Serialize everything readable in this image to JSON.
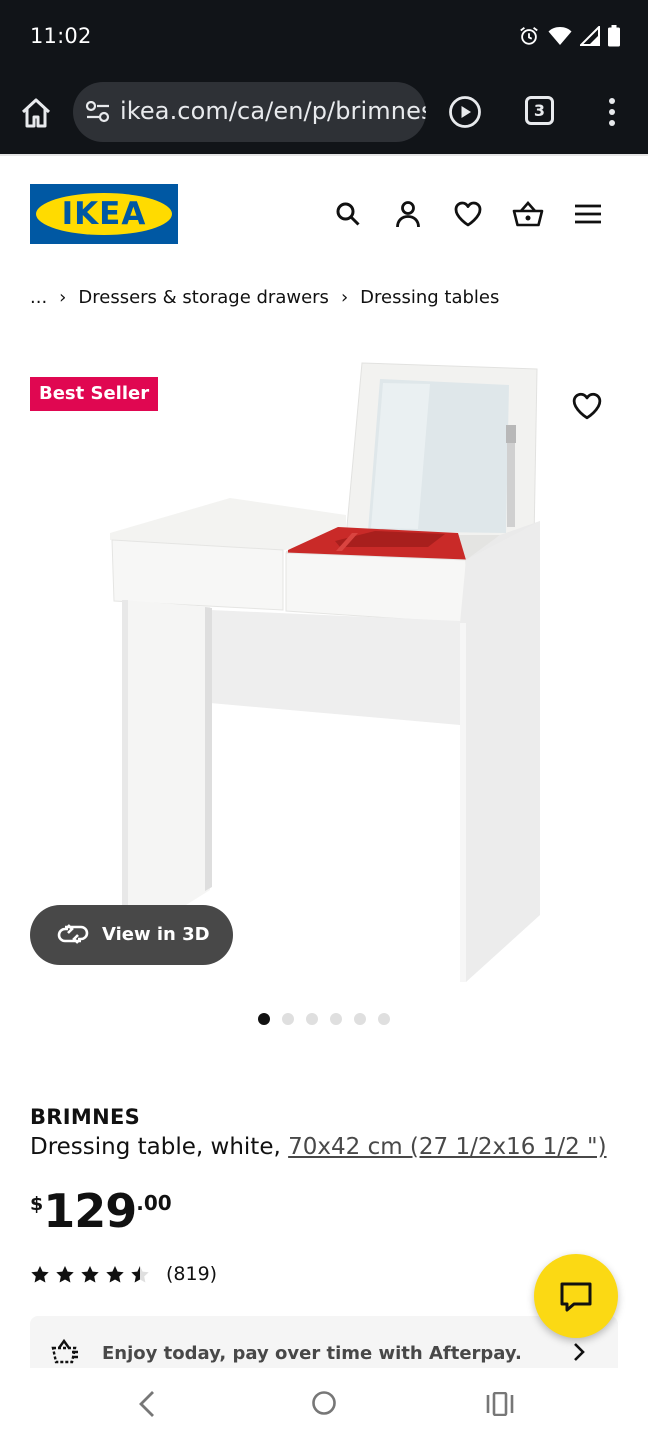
{
  "status_bar": {
    "time": "11:02",
    "icons": [
      "alarm-icon",
      "wifi-icon",
      "signal-icon",
      "battery-icon"
    ]
  },
  "browser": {
    "url": "ikea.com/ca/en/p/brimnes-d",
    "tab_count": "3",
    "icons": [
      "home-icon",
      "tune-icon",
      "play-circle-icon",
      "more-vert-icon"
    ]
  },
  "header": {
    "logo_text": "IKEA",
    "icons": [
      "search-icon",
      "user-icon",
      "heart-icon",
      "basket-icon",
      "menu-icon"
    ],
    "colors": {
      "logo_blue": "#0058a3",
      "logo_yellow": "#ffdb00"
    }
  },
  "breadcrumb": {
    "items": [
      "...",
      "Dressers & storage drawers",
      "Dressing tables"
    ]
  },
  "product": {
    "badge": "Best Seller",
    "badge_color": "#e00751",
    "view_3d_label": "View in 3D",
    "image_count": 6,
    "active_image": 1,
    "name": "BRIMNES",
    "description": "Dressing table, white, ",
    "size": "70x42 cm (27 1/2x16 1/2 \")",
    "price": {
      "currency": "$",
      "integer": "129",
      "decimal": ".00"
    },
    "rating": {
      "value": 4.5,
      "max": 5,
      "count": "(819)"
    }
  },
  "afterpay": {
    "text": "Enjoy today, pay over time with Afterpay."
  },
  "chat": {
    "color": "#fbd914"
  }
}
